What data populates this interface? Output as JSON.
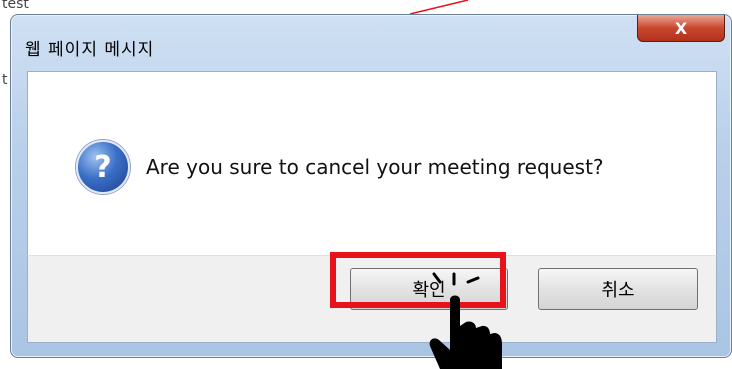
{
  "background": {
    "text_top": "test",
    "text_left": "t"
  },
  "dialog": {
    "title": "웹 페이지 메시지",
    "close_symbol": "X",
    "icon": "question-icon",
    "icon_glyph": "?",
    "message": "Are you sure to cancel your meeting request?",
    "buttons": {
      "ok_label": "확인",
      "cancel_label": "취소"
    }
  },
  "colors": {
    "title_bar": "#b9d0ea",
    "close_button": "#c9462f",
    "highlight": "#e8121b"
  }
}
